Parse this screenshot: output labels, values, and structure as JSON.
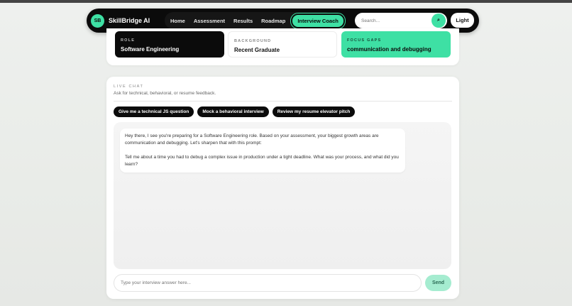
{
  "nav": {
    "logo_initials": "SB",
    "brand": "SkillBridge AI",
    "links": [
      "Home",
      "Assessment",
      "Results",
      "Roadmap"
    ],
    "active_link": "Interview Coach",
    "search_placeholder": "Search...",
    "search_icon": "search-icon",
    "search_icon_glyph": "⌕",
    "theme_label": "Light"
  },
  "profile": {
    "role": {
      "label": "ROLE",
      "value": "Software Engineering"
    },
    "background": {
      "label": "BACKGROUND",
      "value": "Recent Graduate"
    },
    "focus": {
      "label": "FOCUS GAPS",
      "value": "communication and debugging"
    }
  },
  "chat": {
    "eyebrow": "LIVE CHAT",
    "subtitle": "Ask for technical, behavioral, or resume feedback.",
    "chips": [
      "Give me a technical JS question",
      "Mock a behavioral interview",
      "Review my resume elevator pitch"
    ],
    "messages": [
      {
        "from": "coach",
        "line1": "Hey there, I see you're preparing for a Software Engineering role. Based on your assessment, your biggest growth areas are communication and debugging. Let's sharpen that with this prompt:",
        "line2": "Tell me about a time you had to debug a complex issue in production under a tight deadline. What was your process, and what did you learn?"
      }
    ],
    "input_placeholder": "Type your interview answer here...",
    "send_label": "Send"
  },
  "colors": {
    "accent": "#3ee0a4",
    "dark": "#0b0b0b",
    "send_disabled": "#a5ecd0"
  }
}
